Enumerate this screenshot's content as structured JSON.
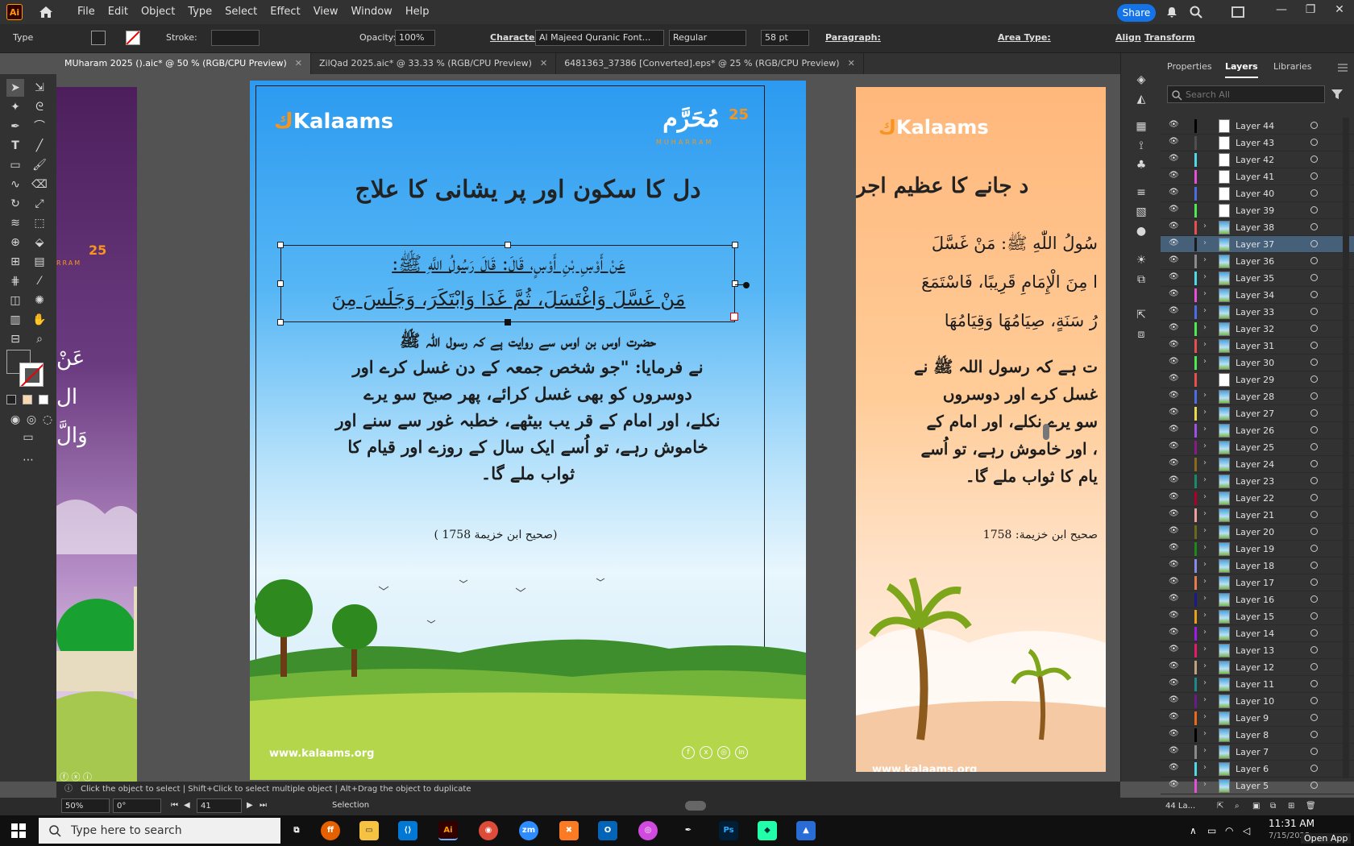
{
  "menubar": {
    "logo": "Ai",
    "items": [
      "File",
      "Edit",
      "Object",
      "Type",
      "Select",
      "Effect",
      "View",
      "Window",
      "Help"
    ],
    "share": "Share"
  },
  "control": {
    "mode": "Type",
    "stroke_label": "Stroke:",
    "opacity_label": "Opacity:",
    "opacity_value": "100%",
    "character_label": "Character:",
    "font": "Al Majeed Quranic Font...",
    "style": "Regular",
    "size": "58 pt",
    "paragraph_label": "Paragraph:",
    "area_type_label": "Area Type:",
    "align": "Align",
    "transform": "Transform"
  },
  "tabs": [
    {
      "label": "MUharam 2025 ().aic* @ 50 % (RGB/CPU Preview)",
      "active": true
    },
    {
      "label": "ZilQad 2025.aic* @ 33.33 % (RGB/CPU Preview)",
      "active": false
    },
    {
      "label": "6481363_37386 [Converted].eps* @ 25 % (RGB/CPU Preview)",
      "active": false
    }
  ],
  "artboard": {
    "brand": "Kalaams",
    "badge_num": "25",
    "badge_sub": "MUHARRAM",
    "title": "دل کا سکون اور پر یشانی کا علاج",
    "arabic_1": "عَنْ أَوْسِ بْنِ أَوْسٍ، قَالَ: قَالَ رَسُولُ اللَّهِ ﷺ:",
    "arabic_2": "مَنْ غَسَّلَ وَاغْتَسَلَ، ثُمَّ غَدَا وَابْتَكَرَ، وَجَلَسَ مِنَ",
    "urdu_1": "حضرت اوس بن اوس سے روایت ہے کہ رسول اللہ ﷺ",
    "urdu_2": "نے فرمایا: \"جو شخص جمعہ کے دن غسل کرے اور",
    "urdu_3": "دوسروں کو بھی غسل کرائے، پھر صبح سو یرے",
    "urdu_4": "نکلے، اور امام کے قر یب بیٹھے، خطبہ غور سے سنے اور",
    "urdu_5": "خاموش رہے، تو اُسے ایک سال کے روزے اور قیام کا",
    "urdu_6": "ثواب ملے گا۔",
    "reference": "(صحیح ابن خزیمة 1758 )",
    "website": "www.kalaams.org"
  },
  "right_artboard": {
    "title": "د جانے کا عظیم اجر",
    "line_1": "سُولُ اللّٰهِ ﷺ: مَنْ غَسَّلَ",
    "line_2": "ا مِنَ الْإِمَامِ قَرِيبًا، فَاسْتَمَعَ",
    "line_3": "رُ سَنَةٍ، صِيَامُهَا وَقِيَامُهَا",
    "line_4": "ت ہے کہ رسول اللہ ﷺ نے",
    "line_5": "غسل کرے اور دوسروں",
    "line_6": "سو یرے نکلے، اور امام کے",
    "line_7": "، اور خاموش رہے، تو اُسے",
    "line_8": "یام کا ثواب ملے گا۔",
    "reference": "صحیح ابن خزیمة: 1758",
    "website": "www.kalaams.org"
  },
  "left_artboard": {
    "badge_num": "25",
    "badge_sub": "RRAM",
    "text_1": "عَنْ",
    "text_2": "ال",
    "text_3": "وَالَّ"
  },
  "panel": {
    "tabs": [
      "Properties",
      "Layers",
      "Libraries"
    ],
    "search_placeholder": "Search All",
    "footer": "44 La..."
  },
  "layers": [
    {
      "name": "Layer 44",
      "color": "#000000",
      "expand": false,
      "sel": false
    },
    {
      "name": "Layer 43",
      "color": "#4f4f4f",
      "expand": false,
      "sel": false
    },
    {
      "name": "Layer 42",
      "color": "#4fd8e8",
      "expand": false,
      "sel": false
    },
    {
      "name": "Layer 41",
      "color": "#e84fd8",
      "expand": false,
      "sel": false
    },
    {
      "name": "Layer 40",
      "color": "#4f6ce8",
      "expand": false,
      "sel": false
    },
    {
      "name": "Layer 39",
      "color": "#4fe84f",
      "expand": false,
      "sel": false
    },
    {
      "name": "Layer 38",
      "color": "#e84f4f",
      "expand": true,
      "sel": false
    },
    {
      "name": "Layer 37",
      "color": "#1a1a1a",
      "expand": true,
      "sel": true
    },
    {
      "name": "Layer 36",
      "color": "#8a8a8a",
      "expand": true,
      "sel": false
    },
    {
      "name": "Layer 35",
      "color": "#4fd8e8",
      "expand": true,
      "sel": false
    },
    {
      "name": "Layer 34",
      "color": "#e84fd8",
      "expand": true,
      "sel": false
    },
    {
      "name": "Layer 33",
      "color": "#4f6ce8",
      "expand": true,
      "sel": false
    },
    {
      "name": "Layer 32",
      "color": "#4fe84f",
      "expand": true,
      "sel": false
    },
    {
      "name": "Layer 31",
      "color": "#e84f4f",
      "expand": true,
      "sel": false
    },
    {
      "name": "Layer 30",
      "color": "#4fe84f",
      "expand": true,
      "sel": false
    },
    {
      "name": "Layer 29",
      "color": "#e84f4f",
      "expand": false,
      "sel": false
    },
    {
      "name": "Layer 28",
      "color": "#4f6ce8",
      "expand": true,
      "sel": false
    },
    {
      "name": "Layer 27",
      "color": "#e8d84f",
      "expand": true,
      "sel": false
    },
    {
      "name": "Layer 26",
      "color": "#a04fe8",
      "expand": true,
      "sel": false
    },
    {
      "name": "Layer 25",
      "color": "#8a1a8a",
      "expand": true,
      "sel": false
    },
    {
      "name": "Layer 24",
      "color": "#8a6a1a",
      "expand": true,
      "sel": false
    },
    {
      "name": "Layer 23",
      "color": "#1a8a6a",
      "expand": true,
      "sel": false
    },
    {
      "name": "Layer 22",
      "color": "#b0002a",
      "expand": true,
      "sel": false
    },
    {
      "name": "Layer 21",
      "color": "#e8a0a0",
      "expand": true,
      "sel": false
    },
    {
      "name": "Layer 20",
      "color": "#6a6a1a",
      "expand": true,
      "sel": false
    },
    {
      "name": "Layer 19",
      "color": "#1a8a1a",
      "expand": true,
      "sel": false
    },
    {
      "name": "Layer 18",
      "color": "#8a8ae8",
      "expand": true,
      "sel": false
    },
    {
      "name": "Layer 17",
      "color": "#e87a4f",
      "expand": true,
      "sel": false
    },
    {
      "name": "Layer 16",
      "color": "#1a1a8a",
      "expand": true,
      "sel": false
    },
    {
      "name": "Layer 15",
      "color": "#e8a01a",
      "expand": true,
      "sel": false
    },
    {
      "name": "Layer 14",
      "color": "#a01ae8",
      "expand": true,
      "sel": false
    },
    {
      "name": "Layer 13",
      "color": "#e81a6a",
      "expand": true,
      "sel": false
    },
    {
      "name": "Layer 12",
      "color": "#c0a080",
      "expand": true,
      "sel": false
    },
    {
      "name": "Layer 11",
      "color": "#1a8a8a",
      "expand": true,
      "sel": false
    },
    {
      "name": "Layer 10",
      "color": "#6a1a8a",
      "expand": true,
      "sel": false
    },
    {
      "name": "Layer 9",
      "color": "#e86a1a",
      "expand": true,
      "sel": false
    },
    {
      "name": "Layer 8",
      "color": "#000000",
      "expand": true,
      "sel": false
    },
    {
      "name": "Layer 7",
      "color": "#8a8a8a",
      "expand": true,
      "sel": false
    },
    {
      "name": "Layer 6",
      "color": "#4fd8e8",
      "expand": true,
      "sel": false
    },
    {
      "name": "Layer 5",
      "color": "#e84fd8",
      "expand": true,
      "sel": false
    }
  ],
  "status": {
    "hint": "Click the object to select  |  Shift+Click to select multiple object  |  Alt+Drag the object to duplicate",
    "zoom": "50%",
    "rotation": "0°",
    "artboard_num": "41",
    "tool": "Selection"
  },
  "taskbar": {
    "search_placeholder": "Type here to search",
    "time": "11:31 AM",
    "date": "7/15/2025",
    "open_app": "Open App"
  }
}
